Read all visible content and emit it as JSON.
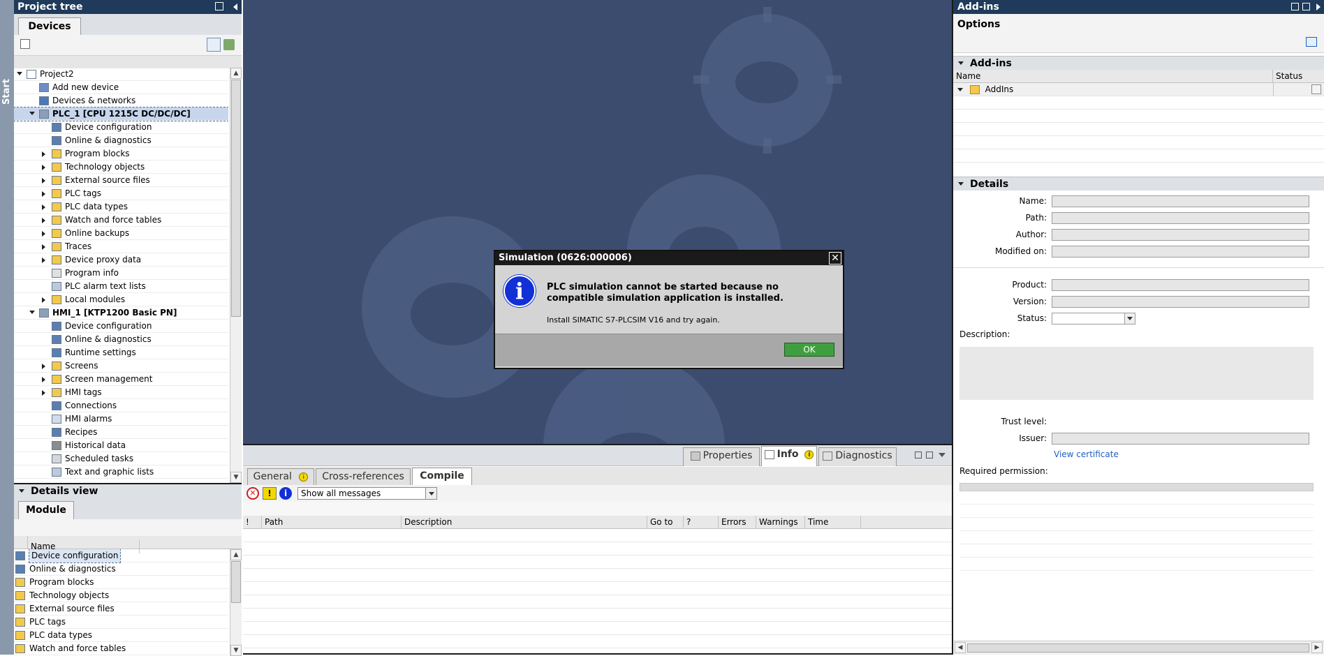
{
  "left_strip": {
    "label": "Start"
  },
  "project_tree": {
    "title": "Project tree",
    "tab": "Devices",
    "items": [
      {
        "label": "Project2",
        "indent": 0,
        "arrow": "down",
        "icon": "project-icon"
      },
      {
        "label": "Add new device",
        "indent": 1,
        "arrow": "",
        "icon": "add-device-icon"
      },
      {
        "label": "Devices & networks",
        "indent": 1,
        "arrow": "",
        "icon": "network-icon"
      },
      {
        "label": "PLC_1 [CPU 1215C DC/DC/DC]",
        "indent": 1,
        "arrow": "down",
        "icon": "plc-icon",
        "selected": true
      },
      {
        "label": "Device configuration",
        "indent": 2,
        "arrow": "",
        "icon": "device-config-icon"
      },
      {
        "label": "Online & diagnostics",
        "indent": 2,
        "arrow": "",
        "icon": "diagnostics-icon"
      },
      {
        "label": "Program blocks",
        "indent": 2,
        "arrow": "right",
        "icon": "folder-icon"
      },
      {
        "label": "Technology objects",
        "indent": 2,
        "arrow": "right",
        "icon": "folder-icon"
      },
      {
        "label": "External source files",
        "indent": 2,
        "arrow": "right",
        "icon": "folder-icon"
      },
      {
        "label": "PLC tags",
        "indent": 2,
        "arrow": "right",
        "icon": "folder-icon"
      },
      {
        "label": "PLC data types",
        "indent": 2,
        "arrow": "right",
        "icon": "folder-icon"
      },
      {
        "label": "Watch and force tables",
        "indent": 2,
        "arrow": "right",
        "icon": "folder-icon"
      },
      {
        "label": "Online backups",
        "indent": 2,
        "arrow": "right",
        "icon": "folder-icon"
      },
      {
        "label": "Traces",
        "indent": 2,
        "arrow": "right",
        "icon": "folder-icon"
      },
      {
        "label": "Device proxy data",
        "indent": 2,
        "arrow": "right",
        "icon": "folder-icon"
      },
      {
        "label": "Program info",
        "indent": 2,
        "arrow": "",
        "icon": "info-doc-icon"
      },
      {
        "label": "PLC alarm text lists",
        "indent": 2,
        "arrow": "",
        "icon": "list-icon"
      },
      {
        "label": "Local modules",
        "indent": 2,
        "arrow": "right",
        "icon": "folder-icon"
      },
      {
        "label": "HMI_1 [KTP1200 Basic PN]",
        "indent": 1,
        "arrow": "down",
        "icon": "hmi-icon"
      },
      {
        "label": "Device configuration",
        "indent": 2,
        "arrow": "",
        "icon": "device-config-icon"
      },
      {
        "label": "Online & diagnostics",
        "indent": 2,
        "arrow": "",
        "icon": "diagnostics-icon"
      },
      {
        "label": "Runtime settings",
        "indent": 2,
        "arrow": "",
        "icon": "settings-icon"
      },
      {
        "label": "Screens",
        "indent": 2,
        "arrow": "right",
        "icon": "folder-icon"
      },
      {
        "label": "Screen management",
        "indent": 2,
        "arrow": "right",
        "icon": "folder-icon"
      },
      {
        "label": "HMI tags",
        "indent": 2,
        "arrow": "right",
        "icon": "folder-icon"
      },
      {
        "label": "Connections",
        "indent": 2,
        "arrow": "",
        "icon": "connection-icon"
      },
      {
        "label": "HMI alarms",
        "indent": 2,
        "arrow": "",
        "icon": "alarm-icon"
      },
      {
        "label": "Recipes",
        "indent": 2,
        "arrow": "",
        "icon": "recipe-icon"
      },
      {
        "label": "Historical data",
        "indent": 2,
        "arrow": "",
        "icon": "history-icon"
      },
      {
        "label": "Scheduled tasks",
        "indent": 2,
        "arrow": "",
        "icon": "task-icon"
      },
      {
        "label": "Text and graphic lists",
        "indent": 2,
        "arrow": "",
        "icon": "list-icon"
      }
    ]
  },
  "details_view": {
    "title": "Details view",
    "tab": "Module",
    "column": "Name",
    "items": [
      {
        "label": "Device configuration",
        "icon": "device-config-icon"
      },
      {
        "label": "Online & diagnostics",
        "icon": "diagnostics-icon"
      },
      {
        "label": "Program blocks",
        "icon": "folder-icon"
      },
      {
        "label": "Technology objects",
        "icon": "folder-icon"
      },
      {
        "label": "External source files",
        "icon": "folder-icon"
      },
      {
        "label": "PLC tags",
        "icon": "folder-icon"
      },
      {
        "label": "PLC data types",
        "icon": "folder-icon"
      },
      {
        "label": "Watch and force tables",
        "icon": "folder-icon"
      }
    ]
  },
  "dialog": {
    "title": "Simulation (0626:000006)",
    "message": "PLC simulation cannot be started because no compatible simulation application is installed.",
    "hint": "Install SIMATIC S7-PLCSIM V16 and try again.",
    "ok": "OK"
  },
  "inspector": {
    "tabs": {
      "properties": "Properties",
      "info": "Info",
      "diagnostics": "Diagnostics"
    },
    "subtabs": [
      "General",
      "Cross-references",
      "Compile"
    ],
    "filter": "Show all messages",
    "columns": [
      "!",
      "Path",
      "Description",
      "Go to",
      "?",
      "Errors",
      "Warnings",
      "Time"
    ]
  },
  "addins": {
    "title": "Add-ins",
    "options": "Options",
    "section": "Add-ins",
    "col_name": "Name",
    "col_status": "Status",
    "folder": "AddIns",
    "details": {
      "title": "Details",
      "name": "Name:",
      "path": "Path:",
      "author": "Author:",
      "modified": "Modified on:",
      "product": "Product:",
      "version": "Version:",
      "status": "Status:",
      "description": "Description:",
      "trust": "Trust level:",
      "issuer": "Issuer:",
      "view_cert": "View certificate",
      "required": "Required permission:"
    }
  },
  "colors": {
    "header": "#1f3a5a",
    "workspace": "#3c4c6f",
    "dialog_title": "#1a1a1a",
    "accent_link": "#1f5fc0"
  }
}
